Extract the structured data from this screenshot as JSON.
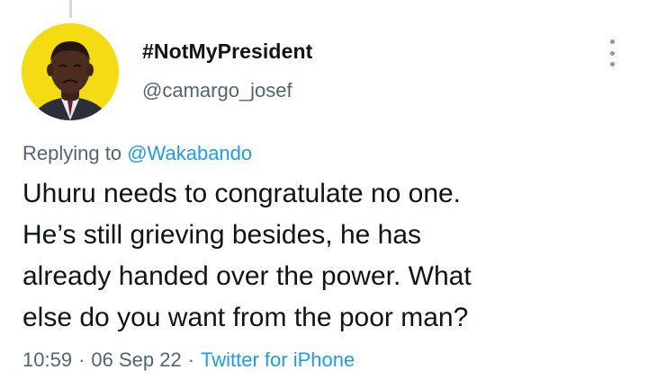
{
  "author": {
    "display_name": "#NotMyPresident",
    "handle": "@camargo_josef",
    "avatar_icon": "user-avatar-photo",
    "avatar_bg": "#f5dc12"
  },
  "more_menu_icon": "vertical-ellipsis-icon",
  "reply": {
    "prefix": "Replying to",
    "mention": "@Wakabando"
  },
  "tweet": {
    "lines": [
      "Uhuru needs to congratulate no one.",
      "He’s still grieving besides, he has",
      "already handed over the power. What",
      "else do you want from the poor man?"
    ]
  },
  "meta": {
    "time": "10:59",
    "separator": "·",
    "date": "06 Sep 22",
    "source": "Twitter for iPhone"
  },
  "colors": {
    "text": "#0f1419",
    "secondary": "#536471",
    "link": "#1d9bf0"
  }
}
